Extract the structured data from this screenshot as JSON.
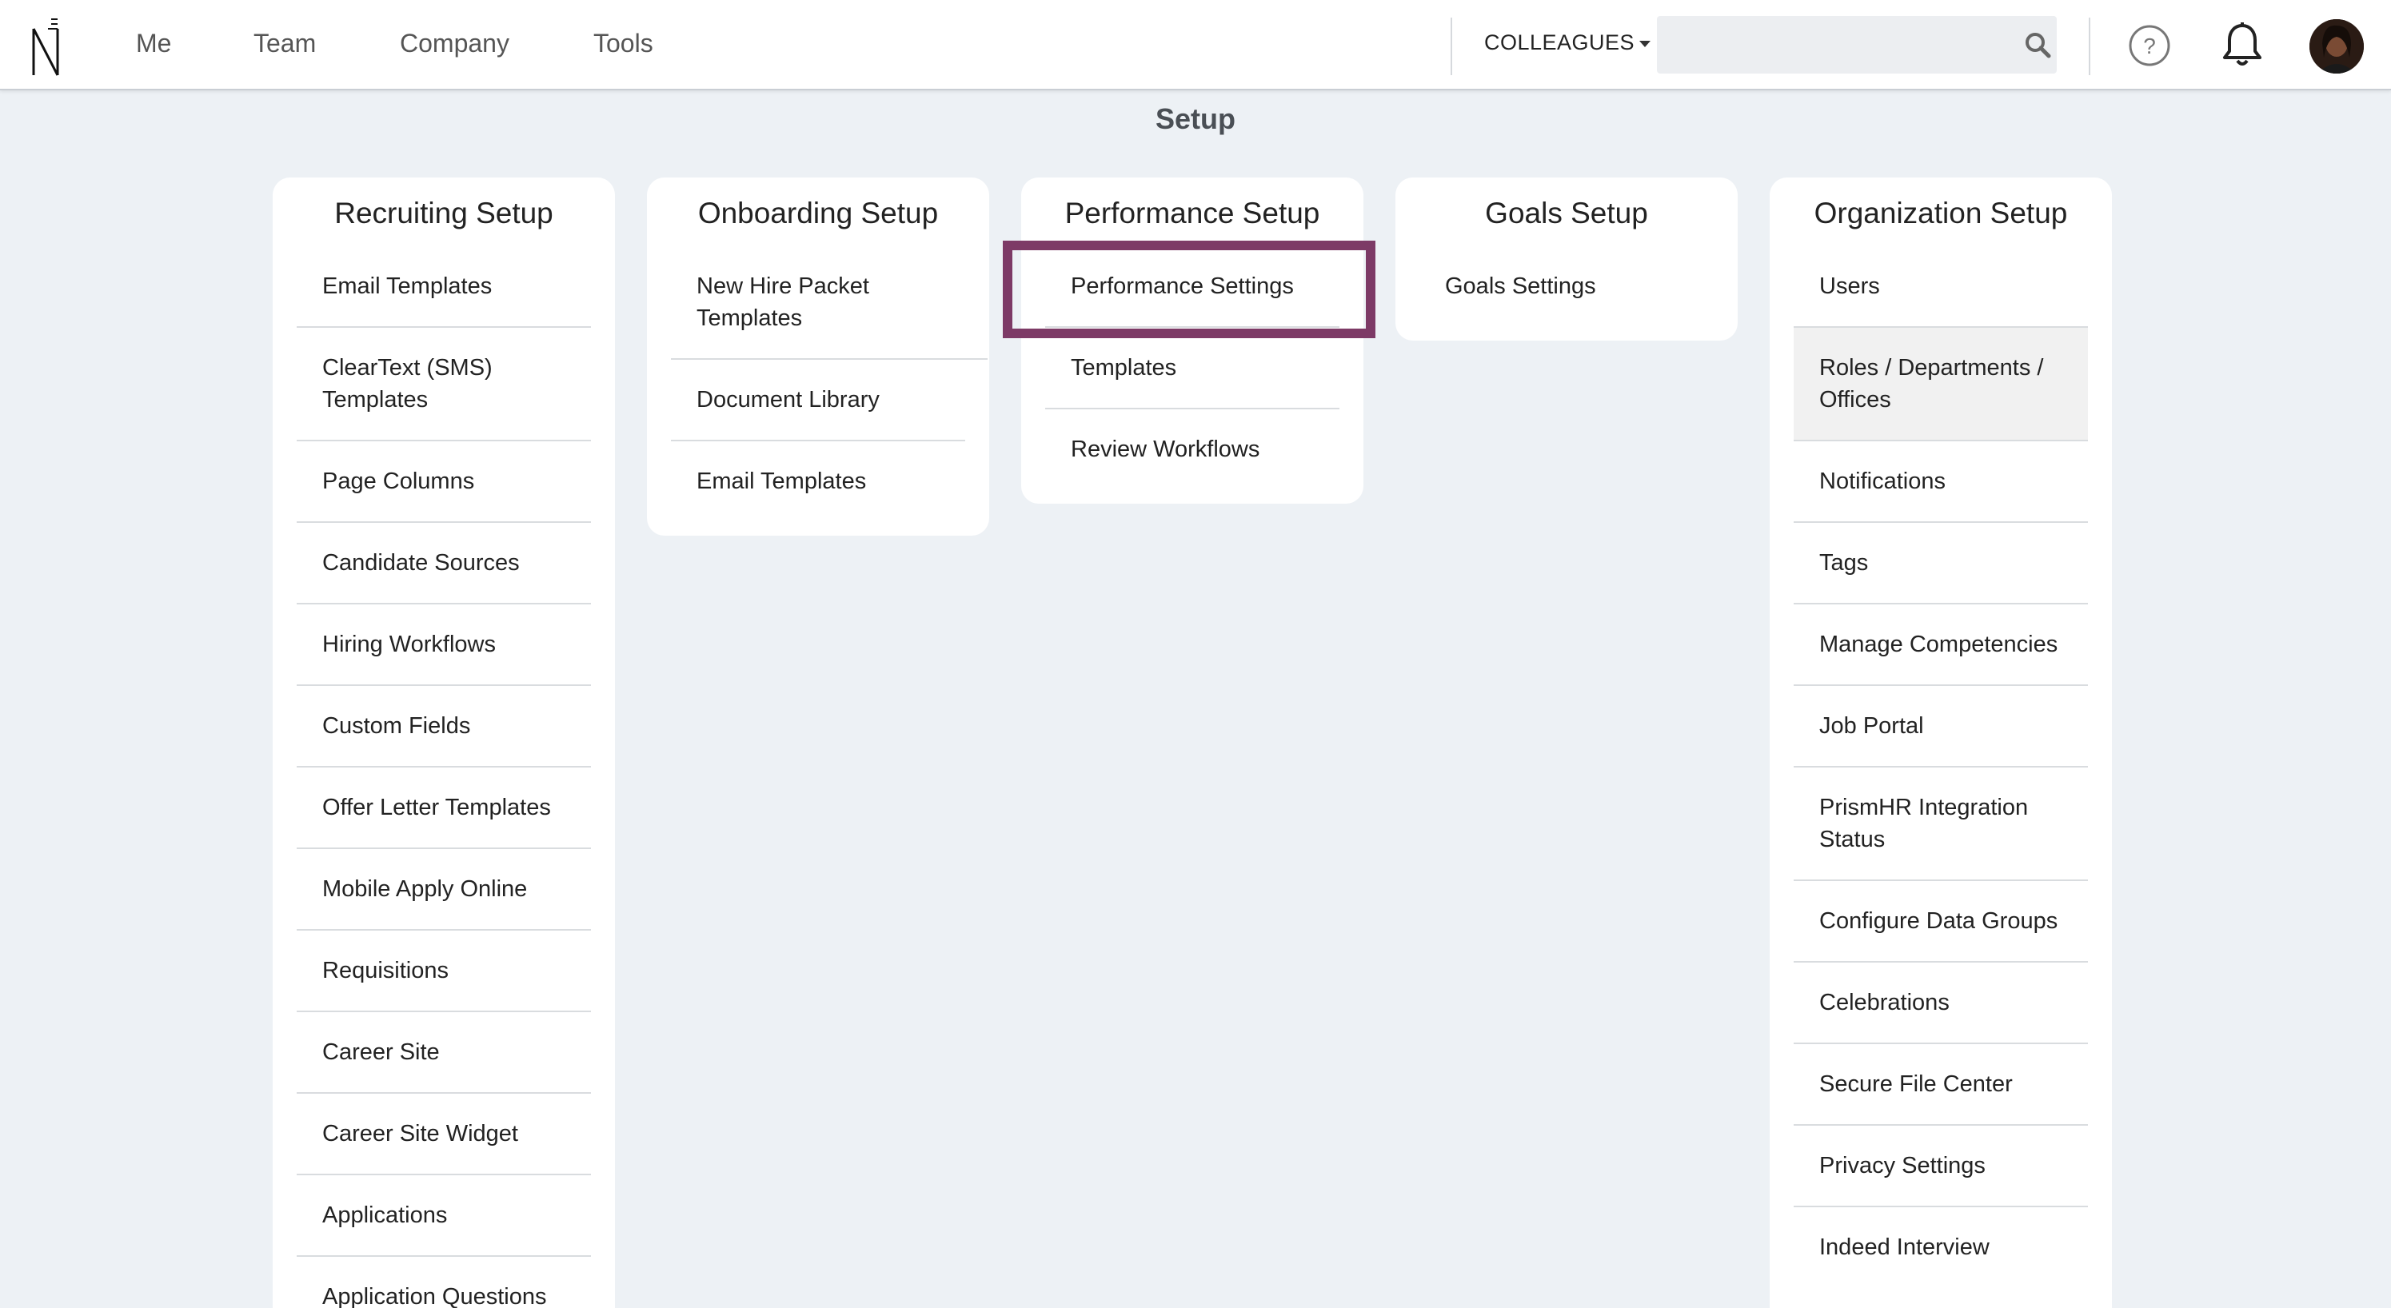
{
  "nav": {
    "items": [
      "Me",
      "Team",
      "Company",
      "Tools"
    ],
    "colleagues_label": "COLLEAGUES",
    "search_value": ""
  },
  "icons": [
    "logo-icon",
    "chevron-down-icon",
    "search-icon",
    "help-icon",
    "bell-icon",
    "avatar"
  ],
  "page_title": "Setup",
  "cards": [
    {
      "title": "Recruiting Setup",
      "items": [
        "Email Templates",
        "ClearText (SMS) Templates",
        "Page Columns",
        "Candidate Sources",
        "Hiring Workflows",
        "Custom Fields",
        "Offer Letter Templates",
        "Mobile Apply Online",
        "Requisitions",
        "Career Site",
        "Career Site Widget",
        "Applications",
        "Application Questions"
      ]
    },
    {
      "title": "Onboarding Setup",
      "items": [
        "New Hire Packet Templates",
        "Document Library",
        "Email Templates"
      ]
    },
    {
      "title": "Performance Setup",
      "items": [
        "Performance Settings",
        "Templates",
        "Review Workflows"
      ]
    },
    {
      "title": "Goals Setup",
      "items": [
        "Goals Settings"
      ]
    },
    {
      "title": "Organization Setup",
      "items": [
        "Users",
        "Roles / Departments / Offices",
        "Notifications",
        "Tags",
        "Manage Competencies",
        "Job Portal",
        "PrismHR Integration Status",
        "Configure Data Groups",
        "Celebrations",
        "Secure File Center",
        "Privacy Settings",
        "Indeed Interview"
      ]
    }
  ],
  "colors": {
    "highlight": "#7d3a66",
    "background": "#edf1f5",
    "card": "#ffffff"
  }
}
